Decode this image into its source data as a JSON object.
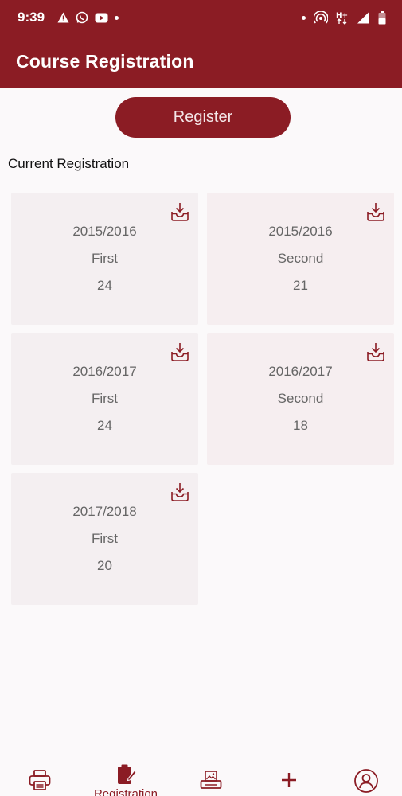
{
  "status_bar": {
    "time": "9:39"
  },
  "app_bar": {
    "title": "Course Registration"
  },
  "actions": {
    "register_label": "Register"
  },
  "section": {
    "title": "Current Registration"
  },
  "registrations": [
    {
      "session": "2015/2016",
      "semester": "First",
      "units": "24"
    },
    {
      "session": "2015/2016",
      "semester": "Second",
      "units": "21"
    },
    {
      "session": "2016/2017",
      "semester": "First",
      "units": "24"
    },
    {
      "session": "2016/2017",
      "semester": "Second",
      "units": "18"
    },
    {
      "session": "2017/2018",
      "semester": "First",
      "units": "20"
    }
  ],
  "bottom_nav": {
    "items": [
      {
        "icon": "printer-icon",
        "label": ""
      },
      {
        "icon": "clipboard-icon",
        "label": "Registration",
        "active": true
      },
      {
        "icon": "image-print-icon",
        "label": ""
      },
      {
        "icon": "plus-icon",
        "label": ""
      },
      {
        "icon": "user-icon",
        "label": ""
      }
    ]
  },
  "colors": {
    "primary": "#8b1c24",
    "card_background": "#f4eff1",
    "card_text": "#666666",
    "page_background": "#fbf9fa"
  }
}
